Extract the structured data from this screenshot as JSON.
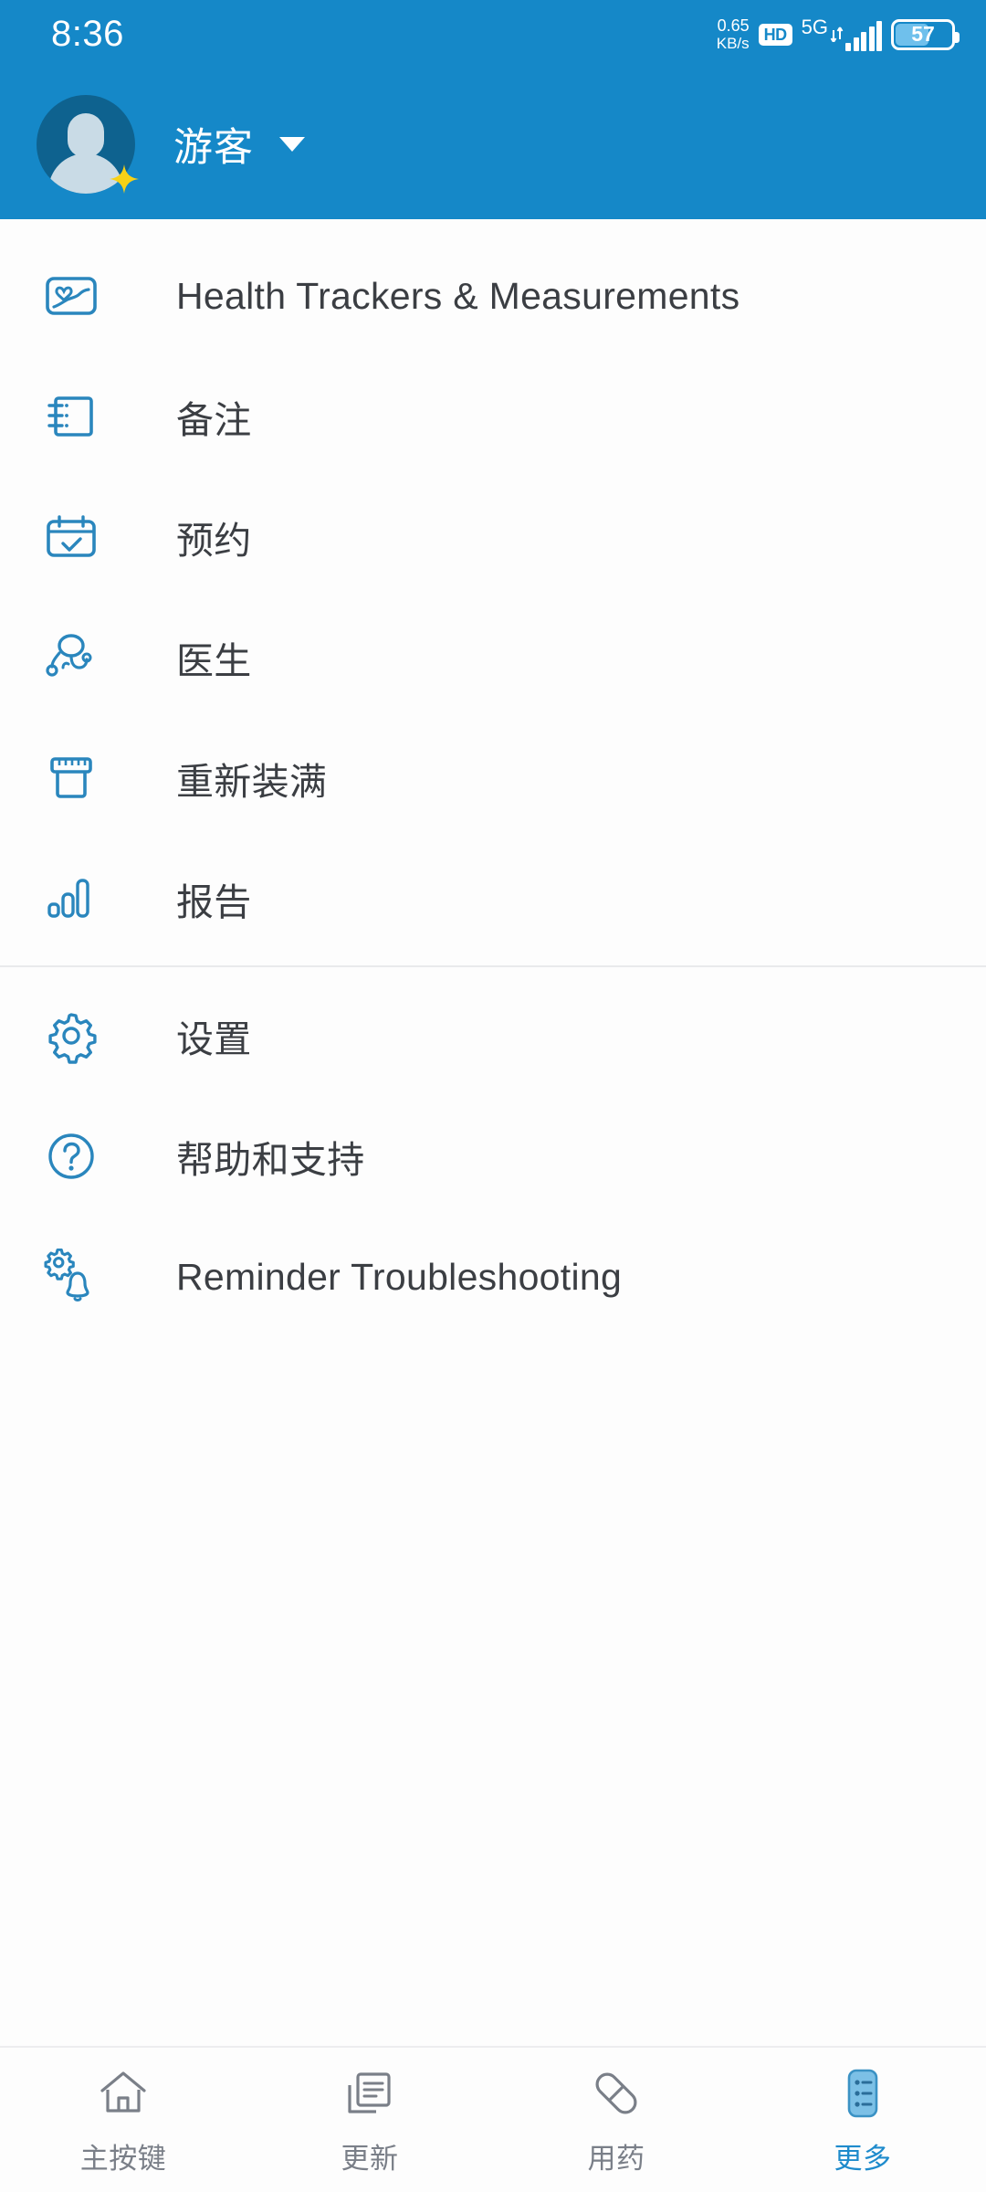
{
  "statusbar": {
    "time": "8:36",
    "network_speed_value": "0.65",
    "network_speed_unit": "KB/s",
    "hd_badge": "HD",
    "network_type": "5G",
    "battery_percent": "57"
  },
  "header": {
    "username": "游客",
    "avatar_name": "guest-avatar",
    "dropdown_icon": "chevron-down-icon",
    "background_color": "#1588c8"
  },
  "menu": {
    "group_one": [
      {
        "label": "Health Trackers & Measurements",
        "icon": "health-tracker-icon"
      },
      {
        "label": "备注",
        "icon": "notes-icon"
      },
      {
        "label": "预约",
        "icon": "calendar-check-icon"
      },
      {
        "label": "医生",
        "icon": "doctor-icon"
      },
      {
        "label": "重新装满",
        "icon": "pill-bottle-icon"
      },
      {
        "label": "报告",
        "icon": "bar-chart-icon"
      }
    ],
    "group_two": [
      {
        "label": "设置",
        "icon": "gear-icon"
      },
      {
        "label": "帮助和支持",
        "icon": "question-circle-icon"
      },
      {
        "label": "Reminder Troubleshooting",
        "icon": "gear-bell-icon"
      }
    ]
  },
  "bottom_nav": {
    "items": [
      {
        "label": "主按键",
        "icon": "home-icon",
        "active": false
      },
      {
        "label": "更新",
        "icon": "refill-documents-icon",
        "active": false
      },
      {
        "label": "用药",
        "icon": "capsule-icon",
        "active": false
      },
      {
        "label": "更多",
        "icon": "list-more-icon",
        "active": true
      }
    ]
  },
  "colors": {
    "accent": "#1588c8",
    "icon_blue": "#2a86bd",
    "text_dark": "#3b3e43",
    "nav_inactive": "#7a7f88",
    "nav_active": "#1e8bcc"
  }
}
